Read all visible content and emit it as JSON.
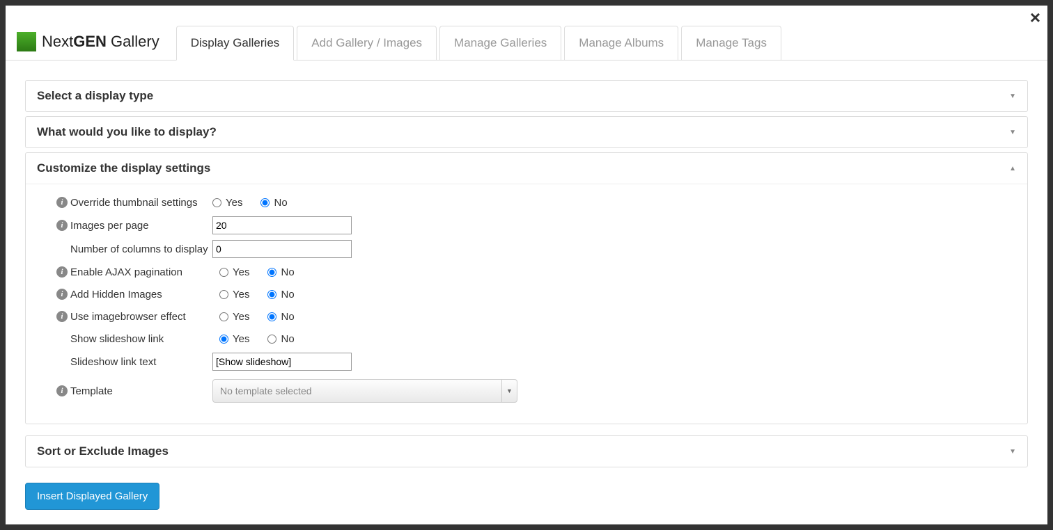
{
  "brand": {
    "prefix": "Next",
    "bold": "GEN",
    "suffix": " Gallery"
  },
  "tabs": [
    {
      "label": "Display Galleries",
      "active": true
    },
    {
      "label": "Add Gallery / Images",
      "active": false
    },
    {
      "label": "Manage Galleries",
      "active": false
    },
    {
      "label": "Manage Albums",
      "active": false
    },
    {
      "label": "Manage Tags",
      "active": false
    }
  ],
  "accordions": {
    "select_type": "Select a display type",
    "what_display": "What would you like to display?",
    "customize": "Customize the display settings",
    "sort_exclude": "Sort or Exclude Images"
  },
  "settings": {
    "yes": "Yes",
    "no": "No",
    "override_thumb": {
      "label": "Override thumbnail settings",
      "value": "No"
    },
    "images_per_page": {
      "label": "Images per page",
      "value": "20"
    },
    "columns": {
      "label": "Number of columns to display",
      "value": "0"
    },
    "ajax": {
      "label": "Enable AJAX pagination",
      "value": "No"
    },
    "hidden": {
      "label": "Add Hidden Images",
      "value": "No"
    },
    "imagebrowser": {
      "label": "Use imagebrowser effect",
      "value": "No"
    },
    "slideshow_link": {
      "label": "Show slideshow link",
      "value": "Yes"
    },
    "slideshow_text": {
      "label": "Slideshow link text",
      "value": "[Show slideshow]"
    },
    "template": {
      "label": "Template",
      "placeholder": "No template selected"
    }
  },
  "insert_button": "Insert Displayed Gallery"
}
